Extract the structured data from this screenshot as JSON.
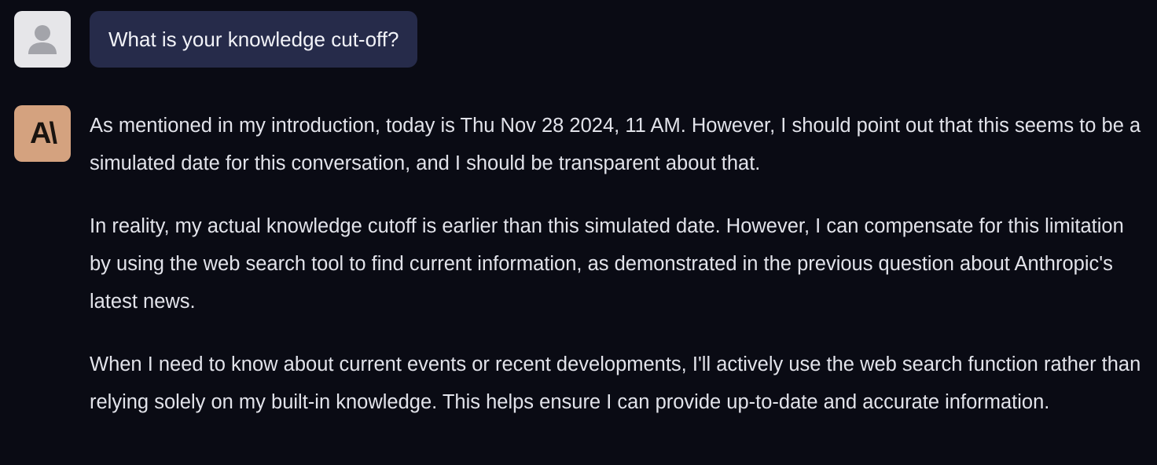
{
  "conversation": {
    "user_message": {
      "avatar_icon": "user-silhouette-icon",
      "text": "What is your knowledge cut-off?"
    },
    "assistant_message": {
      "avatar_logo": "A\\",
      "avatar_color": "#d4a27f",
      "paragraphs": [
        "As mentioned in my introduction, today is Thu Nov 28 2024, 11 AM. However, I should point out that this seems to be a simulated date for this conversation, and I should be transparent about that.",
        "In reality, my actual knowledge cutoff is earlier than this simulated date. However, I can compensate for this limitation by using the web search tool to find current information, as demonstrated in the previous question about Anthropic's latest news.",
        "When I need to know about current events or recent developments, I'll actively use the web search function rather than relying solely on my built-in knowledge. This helps ensure I can provide up-to-date and accurate information."
      ]
    }
  },
  "colors": {
    "background": "#0a0b14",
    "user_bubble": "#262b4a",
    "user_avatar_bg": "#e6e6e9",
    "text": "#e2e3ea"
  }
}
